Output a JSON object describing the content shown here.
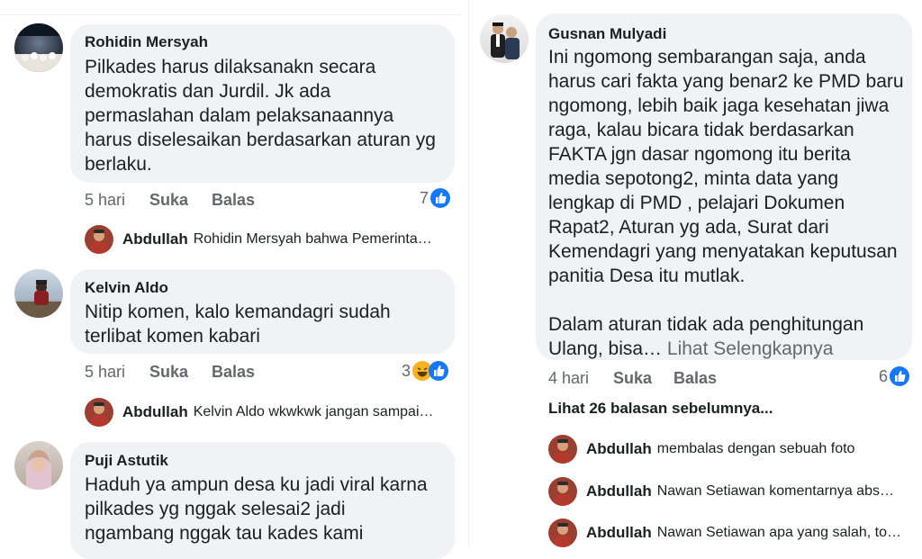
{
  "left": {
    "comments": [
      {
        "author": "Rohidin Mersyah",
        "text": "Pilkades harus dilaksanakn secara\ndemokratis dan Jurdil. Jk ada\npermaslahan dalam pelaksanaannya\nharus diselesaikan berdasarkan aturan yg\nberlaku.",
        "time": "5 hari",
        "like": "Suka",
        "reply": "Balas",
        "reactions": "7",
        "reply_preview": {
          "author": "Abdullah",
          "text": "Rohidin Mersyah  bahwa Pemerinta…"
        }
      },
      {
        "author": "Kelvin Aldo",
        "text": "Nitip komen, kalo kemandagri sudah\nterlibat komen kabari",
        "time": "5 hari",
        "like": "Suka",
        "reply": "Balas",
        "reactions": "3",
        "reply_preview": {
          "author": "Abdullah",
          "text": "Kelvin Aldo wkwkwk jangan sampai…"
        }
      },
      {
        "author": "Puji Astutik",
        "text": "Haduh ya ampun desa ku jadi viral karna\npilkades yg nggak selesai2 jadi\nngambang nggak tau kades kami"
      }
    ]
  },
  "right": {
    "comment": {
      "author": "Gusnan Mulyadi",
      "text": "Ini ngomong sembarangan saja, anda\nharus cari fakta yang benar2 ke PMD baru\nngomong, lebih baik jaga kesehatan jiwa\nraga, kalau bicara tidak berdasarkan\nFAKTA jgn dasar ngomong itu berita\nmedia sepotong2, minta data yang\nlengkap di PMD , pelajari Dokumen\nRapat2, Aturan yg ada, Surat dari\nKemendagri yang menyatakan keputusan\npanitia Desa itu mutlak.\n\nDalam aturan tidak ada penghitungan\nUlang, bisa… ",
      "see_more": "Lihat Selengkapnya",
      "time": "4 hari",
      "like": "Suka",
      "reply": "Balas",
      "reactions": "6"
    },
    "previous_replies": "Lihat 26 balasan sebelumnya...",
    "replies": [
      {
        "author": "Abdullah",
        "text": "membalas dengan sebuah foto"
      },
      {
        "author": "Abdullah",
        "text": "Nawan Setiawan komentarnya abs…"
      },
      {
        "author": "Abdullah",
        "text": "Nawan Setiawan apa yang salah, to…"
      }
    ]
  },
  "colors": {
    "bubble": "#f0f2f5",
    "like": "#1877f2",
    "haha": "#f7b125",
    "muted": "#65676b",
    "text": "#1c1e21"
  },
  "icons": {
    "like": "thumbs-up-icon",
    "haha": "laughing-emoji-icon"
  }
}
